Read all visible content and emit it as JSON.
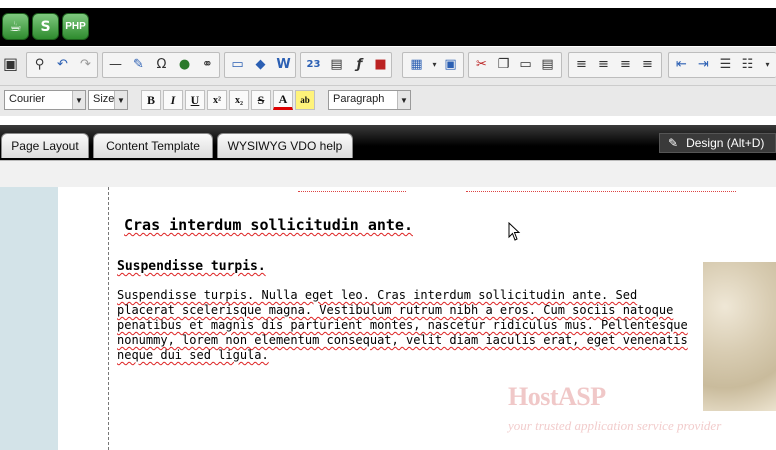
{
  "app_icons": [
    {
      "name": "coffee-app-icon",
      "glyph": "☕"
    },
    {
      "name": "s-app-icon",
      "glyph": "S"
    },
    {
      "name": "php-app-icon",
      "glyph": "PHP"
    }
  ],
  "toolbar": {
    "font_family": "Courier",
    "font_size": "Size",
    "block_format": "Paragraph",
    "format_buttons": [
      "B",
      "I",
      "U",
      "x²",
      "x₂",
      "S",
      "A",
      "ab"
    ]
  },
  "tabs": [
    "Page Layout",
    "Content Template",
    "WYSIWYG VDO help"
  ],
  "design_button": "Design (Alt+D)",
  "content": {
    "heading1": "Cras interdum sollicitudin ante.",
    "heading2": "Suspendisse turpis.",
    "paragraph": "Suspendisse turpis. Nulla eget leo. Cras interdum sollicitudin ante. Sed placerat scelerisque magna. Vestibulum rutrum nibh a eros. Cum sociis natoque penatibus et magnis dis parturient montes, nascetur ridiculus mus. Pellentesque nonummy, lorem non elementum consequat, velit diam iaculis erat, eget venenatis neque dui sed ligula."
  },
  "watermark": {
    "brand_host": "Host",
    "brand_asp": "ASP",
    "tagline": "your trusted application service provider"
  },
  "colors": {
    "accent_green": "#2e8b2e",
    "left_pane": "#d3e3e8",
    "spell_underline": "#dd2222"
  }
}
